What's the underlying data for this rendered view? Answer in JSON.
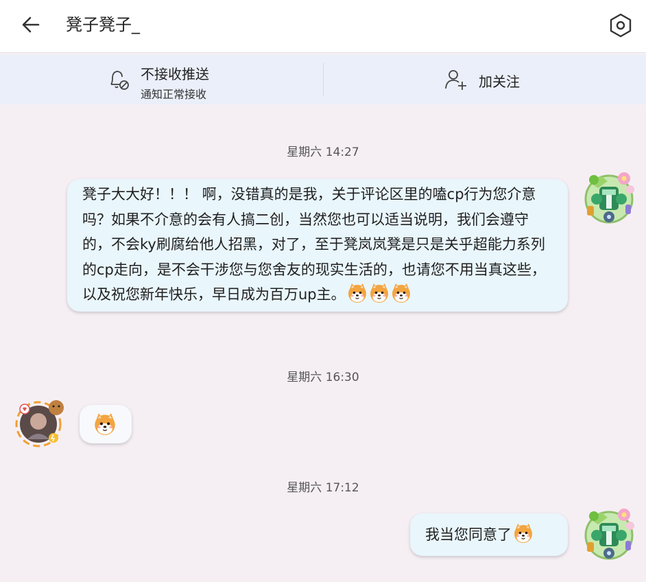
{
  "header": {
    "title": "凳子凳子_",
    "back_icon": "arrow-left-icon",
    "settings_icon": "hexagon-settings-icon"
  },
  "actions": {
    "push": {
      "icon": "bell-off-icon",
      "title": "不接收推送",
      "subtitle": "通知正常接收"
    },
    "follow": {
      "icon": "add-user-icon",
      "label": "加关注"
    }
  },
  "messages": [
    {
      "time": "星期六 14:27",
      "side": "right",
      "text": "凳子大大好！！！ 啊，没错真的是我，关于评论区里的嗑cp行为您介意吗？如果不介意的会有人搞二创，当然您也可以适当说明，我们会遵守的，不会ky刷腐给他人招黑，对了，至于凳岚岚凳是只是关乎超能力系列的cp走向，是不会干涉您与您舍友的现实生活的，也请您不用当真这些，以及祝您新年快乐，早日成为百万up主。",
      "emojis": [
        "shiba-emoji",
        "shiba-emoji",
        "shiba-emoji"
      ]
    },
    {
      "time": "星期六 16:30",
      "side": "left",
      "text": "",
      "emojis": [
        "shiba-emoji"
      ]
    },
    {
      "time": "星期六 17:12",
      "side": "right",
      "text": "我当您同意了",
      "emojis": [
        "shiba-emoji"
      ]
    }
  ],
  "colors": {
    "background": "#f5eff4",
    "action_bar": "#eaeff9",
    "bubble": "#e9f6fc"
  }
}
